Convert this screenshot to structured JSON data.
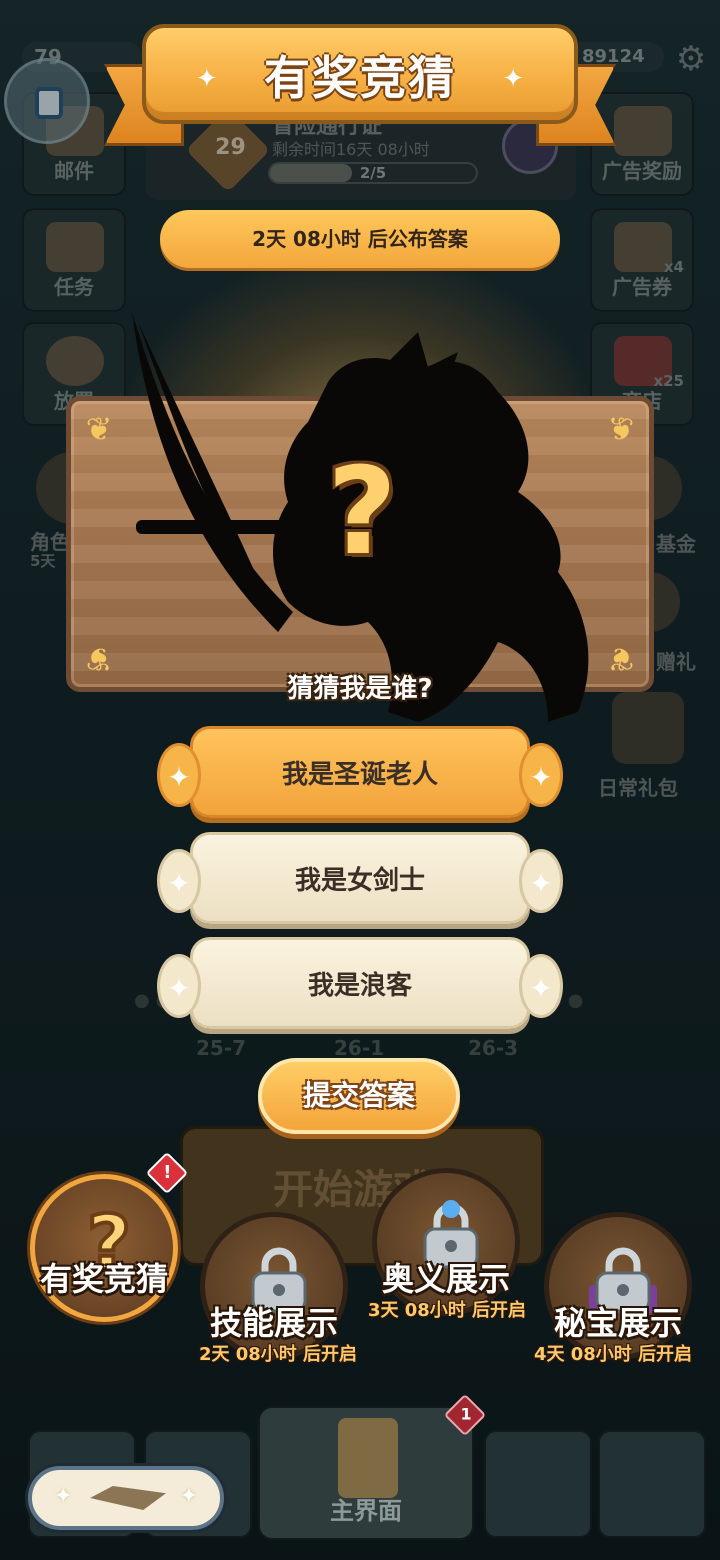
{
  "app": {
    "level": "79",
    "coins": "89124"
  },
  "side_menu": {
    "left": [
      {
        "label": "邮件",
        "icon": "mail-icon"
      },
      {
        "label": "任务",
        "icon": "scroll-icon"
      },
      {
        "label": "放置",
        "icon": "idle-clock-icon"
      },
      {
        "label": "角色",
        "sub": "5天",
        "icon": "character-icon"
      }
    ],
    "right": [
      {
        "label": "广告奖励",
        "icon": "video-ad-icon"
      },
      {
        "label": "广告券",
        "count": "x4",
        "icon": "ad-ticket-icon"
      },
      {
        "label": "商店",
        "count": "x25",
        "icon": "gem-shop-icon"
      },
      {
        "label": "基金",
        "icon": "fund-icon"
      },
      {
        "label": "赠礼",
        "icon": "gift-icon"
      },
      {
        "label": "日常礼包",
        "icon": "daily-pack-icon"
      }
    ]
  },
  "battle_pass": {
    "level": "29",
    "title": "冒险通行证",
    "time_left": "剩余时间16天 08小时",
    "progress_text": "2/5",
    "progress": 0.4
  },
  "background_stages": [
    "25-7",
    "26-1",
    "26-3"
  ],
  "start_button": {
    "label": "开始游戏"
  },
  "popup": {
    "title": "有奖竞猜",
    "countdown": "2天 08小时 后公布答案",
    "question": "猜猜我是谁?",
    "options": [
      {
        "label": "我是圣诞老人",
        "selected": true
      },
      {
        "label": "我是女剑士",
        "selected": false
      },
      {
        "label": "我是浪客",
        "selected": false
      }
    ],
    "submit_label": "提交答案"
  },
  "categories": [
    {
      "label": "有奖竞猜",
      "sub": "",
      "state": "active",
      "badge": "!"
    },
    {
      "label": "技能展示",
      "sub": "2天 08小时 后开启",
      "state": "locked"
    },
    {
      "label": "奥义展示",
      "sub": "3天 08小时 后开启",
      "state": "locked"
    },
    {
      "label": "秘宝展示",
      "sub": "4天 08小时 后开启",
      "state": "locked"
    }
  ],
  "bottom_nav": {
    "main_label": "主界面",
    "badge": "1"
  },
  "colors": {
    "accent": "#f6b044",
    "panel": "#a47650",
    "option_selected": "#ffc35c",
    "option_normal": "#fbf3df",
    "badge_red": "#d9323a"
  }
}
